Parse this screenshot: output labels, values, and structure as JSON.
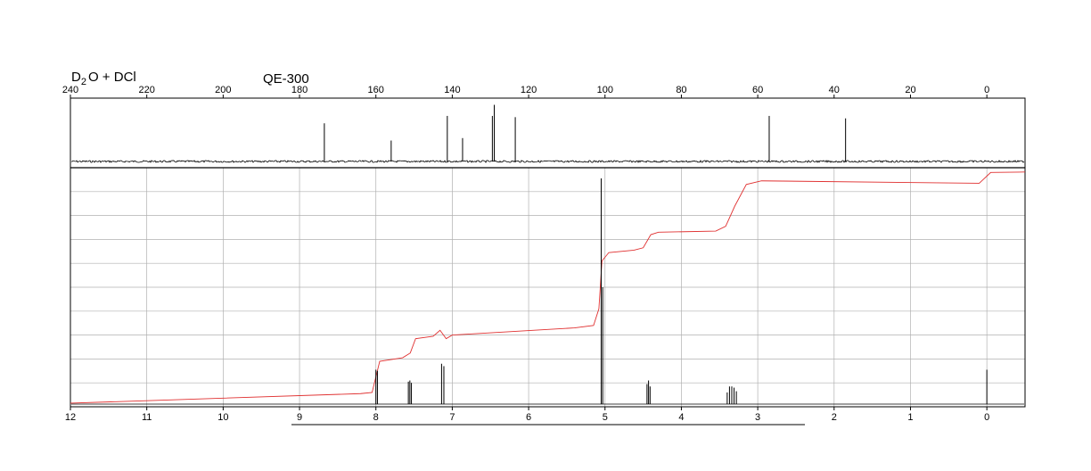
{
  "header": {
    "solvent_main": "D",
    "solvent_sub": "2",
    "solvent_rest": "O + DCl",
    "instrument": "QE-300"
  },
  "colors": {
    "spectrum": "#000000",
    "integral": "#e03030",
    "grid": "#b0b0b0",
    "frame": "#000000"
  },
  "chart_data": [
    {
      "type": "line",
      "name": "13C spectrum",
      "xlim": [
        240,
        -10
      ],
      "x_reversed": true,
      "ticks": [
        240,
        220,
        200,
        180,
        160,
        140,
        120,
        100,
        80,
        60,
        40,
        20,
        0
      ],
      "grid": false,
      "ylim": [
        0,
        1
      ],
      "baseline": 0.08,
      "peaks": [
        {
          "x": 173.5,
          "h": 0.62
        },
        {
          "x": 156.0,
          "h": 0.34
        },
        {
          "x": 141.3,
          "h": 0.74
        },
        {
          "x": 137.3,
          "h": 0.38
        },
        {
          "x": 129.5,
          "h": 0.74
        },
        {
          "x": 129.0,
          "h": 0.92
        },
        {
          "x": 123.5,
          "h": 0.72
        },
        {
          "x": 57.0,
          "h": 0.74
        },
        {
          "x": 37.0,
          "h": 0.7
        }
      ]
    },
    {
      "type": "line",
      "name": "1H spectrum",
      "xlim": [
        12,
        -0.5
      ],
      "x_reversed": true,
      "ticks": [
        12,
        11,
        10,
        9,
        8,
        7,
        6,
        5,
        4,
        3,
        2,
        1,
        0
      ],
      "grid": true,
      "ylim": [
        0,
        10
      ],
      "peaks": [
        {
          "x": 8.0,
          "h": 1.55
        },
        {
          "x": 7.98,
          "h": 1.5
        },
        {
          "x": 7.575,
          "h": 1.05
        },
        {
          "x": 7.555,
          "h": 1.1
        },
        {
          "x": 7.535,
          "h": 1.0
        },
        {
          "x": 7.14,
          "h": 1.8
        },
        {
          "x": 7.11,
          "h": 1.7
        },
        {
          "x": 5.05,
          "h": 9.55
        },
        {
          "x": 5.03,
          "h": 5.0
        },
        {
          "x": 4.45,
          "h": 0.95
        },
        {
          "x": 4.43,
          "h": 1.1
        },
        {
          "x": 4.41,
          "h": 0.85
        },
        {
          "x": 3.4,
          "h": 0.6
        },
        {
          "x": 3.37,
          "h": 0.85
        },
        {
          "x": 3.34,
          "h": 0.85
        },
        {
          "x": 3.31,
          "h": 0.8
        },
        {
          "x": 3.28,
          "h": 0.65
        },
        {
          "x": 0.0,
          "h": 1.55
        }
      ],
      "integral": [
        {
          "x": 12.0,
          "y": 0.15
        },
        {
          "x": 8.2,
          "y": 0.55
        },
        {
          "x": 8.05,
          "y": 0.6
        },
        {
          "x": 7.95,
          "y": 1.9
        },
        {
          "x": 7.65,
          "y": 2.05
        },
        {
          "x": 7.55,
          "y": 2.25
        },
        {
          "x": 7.48,
          "y": 2.85
        },
        {
          "x": 7.25,
          "y": 2.95
        },
        {
          "x": 7.16,
          "y": 3.2
        },
        {
          "x": 7.08,
          "y": 2.85
        },
        {
          "x": 7.0,
          "y": 3.0
        },
        {
          "x": 5.4,
          "y": 3.3
        },
        {
          "x": 5.15,
          "y": 3.4
        },
        {
          "x": 5.08,
          "y": 4.1
        },
        {
          "x": 5.04,
          "y": 6.1
        },
        {
          "x": 4.95,
          "y": 6.45
        },
        {
          "x": 4.62,
          "y": 6.55
        },
        {
          "x": 4.5,
          "y": 6.65
        },
        {
          "x": 4.4,
          "y": 7.2
        },
        {
          "x": 4.3,
          "y": 7.3
        },
        {
          "x": 3.55,
          "y": 7.35
        },
        {
          "x": 3.42,
          "y": 7.55
        },
        {
          "x": 3.3,
          "y": 8.4
        },
        {
          "x": 3.15,
          "y": 9.3
        },
        {
          "x": 2.95,
          "y": 9.45
        },
        {
          "x": 0.1,
          "y": 9.35
        },
        {
          "x": 0.05,
          "y": 9.5
        },
        {
          "x": -0.05,
          "y": 9.8
        },
        {
          "x": -0.5,
          "y": 9.82
        }
      ]
    }
  ]
}
